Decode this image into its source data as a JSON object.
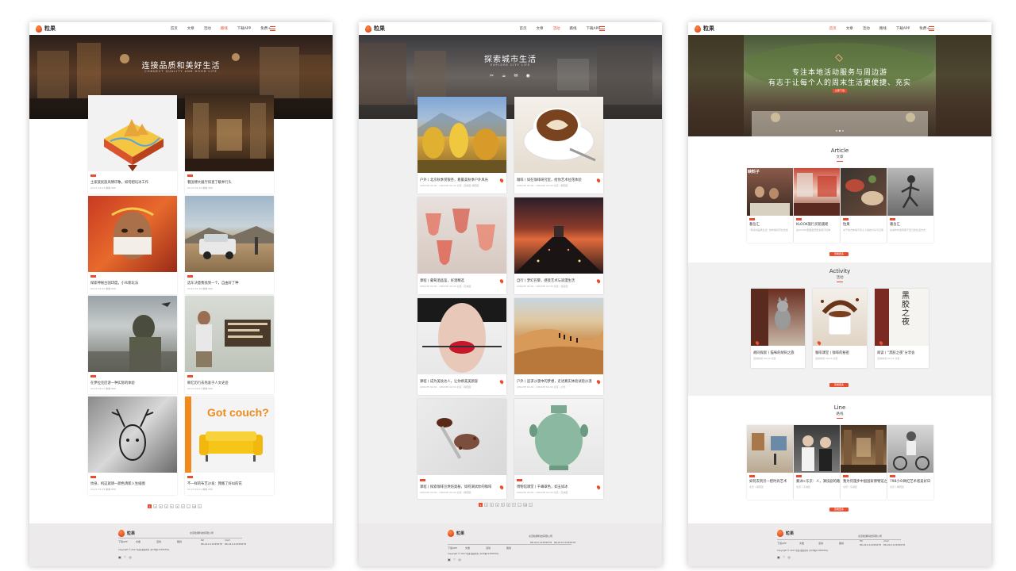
{
  "brand": {
    "name": "粒果",
    "accent": "#e94d2e"
  },
  "nav": {
    "items": [
      "首页",
      "文章",
      "活动",
      "路线",
      "下载APP",
      "免费+"
    ],
    "p1_active": 3,
    "p2_active": 2,
    "p3_active": 0
  },
  "page1": {
    "hero_title": "连接品质和美好生活",
    "hero_sub": "CONNECT QUALITY AND GOOD LIFE",
    "cards": [
      {
        "title": "土家族民族风情印象，如何把玩冰工作",
        "meta": "09.21 09:03  看看·888"
      },
      {
        "title": "看国博大展厅排查了解并行头",
        "meta": "09.23 09:18  看看·888"
      },
      {
        "title": "探索神秘古国印度，小众新玩法",
        "meta": "09.22 09:30  看看·888"
      },
      {
        "title": "选车决意我找到一个，自由好了种",
        "meta": "09.22 09:18  看看·888"
      },
      {
        "title": "在伊拉克店游一种实际的体验",
        "meta": "09.23 09:01  看看·888"
      },
      {
        "title": "韩忆历行去热衷于人文史迹",
        "meta": "09.23 09:01  看看·888"
      },
      {
        "title": "纹身，机这就请一颜色清新入生插图",
        "meta": "09.21 09:03  看看·888"
      },
      {
        "title": "不一样的布艺沙发：我搬了好似的花",
        "meta": "09.23 09:01  看看·888"
      }
    ],
    "couch_text": "Got couch?",
    "pager": [
      "1",
      "2",
      "3",
      "4",
      "5",
      "6",
      "7",
      "...",
      "18",
      ">"
    ]
  },
  "page2": {
    "hero_title": "探索城市生活",
    "hero_sub": "EXPLORE CITY LIFE",
    "icons": [
      "✂",
      "☕",
      "✉",
      "◉"
    ],
    "cards": [
      {
        "title": "户外丨北京秋季赏银杏，看最美秋季户外风光",
        "meta": "UPDATE 09:30 · UPDATE 09:30 北京丨西城区·朝阳区"
      },
      {
        "title": "咖啡丨如在咖啡研究室，给你艺术拉花体验",
        "meta": "UPDATE 09:30 · UPDATE 09:30 北京丨朝阳区"
      },
      {
        "title": "课程丨葡萄酒品鉴，好酒精选",
        "meta": "UPDATE 09:30 · UPDATE 09:30 北京丨东城区"
      },
      {
        "title": "自行丨梦幻巴黎，感受艺术与浪漫生活",
        "meta": "UPDATE 09:30 · UPDATE 09:30 北京丨海淀区"
      },
      {
        "title": "课程丨成为美妆达人，让你焕美美颜容",
        "meta": "UPDATE 09:30 · UPDATE 09:30 北京丨朝阳区"
      },
      {
        "title": "户外丨追求沙漠中的梦想，走进真实体验试验沙漠",
        "meta": "UPDATE 09:30 · UPDATE 09:30 北京丨户外"
      },
      {
        "title": "课程丨探索咖啡豆烘焙奥秘，如何调试你的咖啡",
        "meta": "UPDATE 09:30 · UPDATE 09:30 北京丨朝阳区"
      },
      {
        "title": "博物馆课堂丨千峰翠色，如玉如冰",
        "meta": "UPDATE 09:30 · UPDATE 09:30 北京丨东城区"
      }
    ],
    "pager": [
      "1",
      "2",
      "3",
      "4",
      "5",
      "6",
      "7",
      "...",
      "18",
      ">"
    ]
  },
  "page3": {
    "hero_line1": "专注本地活动服务与周边游",
    "hero_line2": "有志于让每个人的周末生活更便捷、充实",
    "hero_btn": "立即下载",
    "article": {
      "title": "Article",
      "sub": "文章",
      "overlay": "映料子",
      "items": [
        {
          "title": "葛岳汇",
          "meta": "“有好的品质生活” 的吃喝玩乐好去处"
        },
        {
          "title": "KLOOK旅行买赔版呢",
          "meta": "在KLOOK里面发现更多旅行好物"
        },
        {
          "title": "粒果",
          "meta": "关于地方体验与风土人情的分享与记录"
        },
        {
          "title": "葛岳汇",
          "meta": "在城市中发现属于自己的生活方式"
        }
      ],
      "more": "查看更多"
    },
    "activity": {
      "title": "Activity",
      "sub": "活动",
      "items": [
        {
          "title": "胡同探索丨猫咪的胡同之旅",
          "meta": "活动时间 09.23 北京"
        },
        {
          "title": "咖啡课堂丨咖啡的秘密",
          "meta": "活动时间 09.23 北京"
        },
        {
          "title": "阅读丨“黑胶之夜”分享会",
          "meta": "活动时间 09.23 北京"
        }
      ],
      "poster_text": "黑胶之夜",
      "more": "查看更多"
    },
    "line": {
      "title": "Line",
      "sub": "路线",
      "items": [
        {
          "title": "如何去到另一把时尚艺术",
          "meta": "北京丨朝阳区"
        },
        {
          "title": "蒙洲×东京：人，演技剧的路",
          "meta": "北京丨东城区"
        },
        {
          "title": "我为何漫步中国国家博物馆之旅",
          "meta": "北京丨东城区"
        },
        {
          "title": "798小众网红艺术者美好日",
          "meta": "北京丨朝阳区"
        }
      ],
      "more": "查看更多"
    }
  },
  "footer": {
    "company": "北京粒果科技有限公司",
    "links": [
      "下载APP",
      "文章",
      "活动",
      "路线"
    ],
    "tel_label": "Tel",
    "tel": "86-010-12345678",
    "mail_label": "mail",
    "mail": "86-010-12345678",
    "copyright": "Copyright © 2017 粒果 版权所有 京ICP备12345678号",
    "icons": [
      "▣",
      "♡",
      "◎"
    ]
  }
}
